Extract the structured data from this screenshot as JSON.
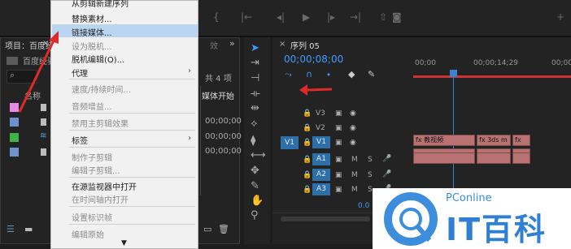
{
  "menu": {
    "partial_top": "从剪辑新建序列",
    "items": [
      {
        "label": "替换素材...",
        "enabled": true
      },
      {
        "label": "链接媒体...",
        "enabled": true,
        "highlighted": true
      },
      {
        "label": "设为脱机...",
        "enabled": false
      },
      {
        "label": "脱机编辑(O)...",
        "enabled": true
      },
      {
        "label": "代理",
        "enabled": true,
        "submenu": true
      },
      {
        "label": "速度/持续时间...",
        "enabled": false
      },
      {
        "label": "音频增益...",
        "enabled": false
      },
      {
        "label": "禁用主剪辑效果",
        "enabled": false
      },
      {
        "label": "标签",
        "enabled": true,
        "submenu": true
      },
      {
        "label": "制作子剪辑",
        "enabled": false
      },
      {
        "label": "编辑子剪辑...",
        "enabled": false
      },
      {
        "label": "在源监视器中打开",
        "enabled": true
      },
      {
        "label": "在时间轴内打开",
        "enabled": false
      },
      {
        "label": "设置标识帧",
        "enabled": false
      },
      {
        "label": "编辑原始",
        "enabled": false
      }
    ],
    "scroll_down": "▼"
  },
  "project": {
    "title": "项目：百度经验",
    "close": "×",
    "extra": "效",
    "menu_dots": "»",
    "bin_label": "百度经验",
    "item_count": "共 4 项",
    "col_name": "名称",
    "col_media_start": "媒体开始",
    "rows": [
      {
        "color": "#e58be6",
        "value": ""
      },
      {
        "color": "#6e93cc",
        "value": "00;00;00"
      },
      {
        "color": "#3fb24a",
        "value": "00;00;00"
      },
      {
        "color": "#6e93cc",
        "value": "00;00;00"
      }
    ]
  },
  "timeline": {
    "close": "×",
    "title": "序列 05",
    "menu": "≡",
    "timecode": "00;00;08;00",
    "ruler": [
      "00;00",
      "00;00;14;29",
      "00;00;"
    ],
    "tracks": [
      {
        "name": "V3",
        "type": "video"
      },
      {
        "name": "V2",
        "type": "video"
      },
      {
        "name": "V1",
        "type": "video"
      },
      {
        "name": "A1",
        "type": "audio"
      },
      {
        "name": "A2",
        "type": "audio"
      },
      {
        "name": "A3",
        "type": "audio"
      }
    ],
    "source_patch": "V1",
    "clip_labels": [
      "fx 教视频",
      "fx 3ds m",
      "fx"
    ],
    "level": "0.0"
  },
  "watermark": {
    "brand": "PConline",
    "title": "IT百科"
  },
  "colors": {
    "accent": "#3e9cff",
    "highlight": "#b9d5f2",
    "arrow": "#e02a2a"
  }
}
